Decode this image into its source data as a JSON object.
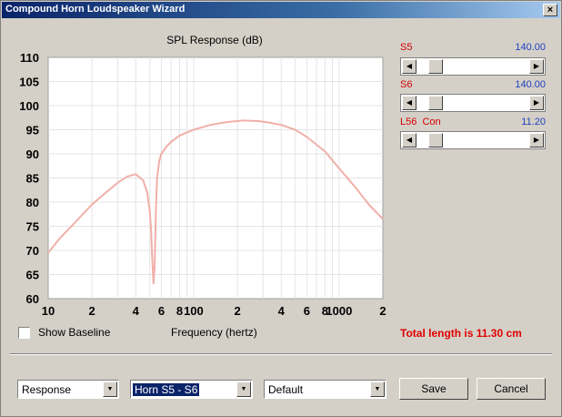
{
  "window": {
    "title": "Compound Horn Loudspeaker Wizard",
    "close_glyph": "×"
  },
  "sliders": [
    {
      "label": "S5",
      "value": "140.00",
      "level": 0.12
    },
    {
      "label": "S6",
      "value": "140.00",
      "level": 0.12
    },
    {
      "label": "L56  Con",
      "value": "11.20",
      "level": 0.12
    }
  ],
  "show_baseline": {
    "label": "Show Baseline",
    "checked": false
  },
  "total_length": "Total length is 11.30 cm",
  "bottom": {
    "view_select": "Response",
    "horn_select": "Horn S5 - S6",
    "preset_select": "Default",
    "save_label": "Save",
    "cancel_label": "Cancel"
  },
  "colors": {
    "curve": "#f0b0a8",
    "label_red": "#d40000",
    "value_blue": "#2040c0"
  },
  "chart_data": {
    "type": "line",
    "title": "SPL Response (dB)",
    "xlabel": "Frequency (hertz)",
    "ylabel": "",
    "x_scale": "log",
    "xlim": [
      10,
      2000
    ],
    "ylim": [
      60,
      110
    ],
    "y_ticks": [
      60,
      65,
      70,
      75,
      80,
      85,
      90,
      95,
      100,
      105,
      110
    ],
    "x_ticks": [
      {
        "v": 10,
        "label": "10"
      },
      {
        "v": 20,
        "label": "2"
      },
      {
        "v": 40,
        "label": "4"
      },
      {
        "v": 60,
        "label": "6"
      },
      {
        "v": 80,
        "label": "8"
      },
      {
        "v": 100,
        "label": "100"
      },
      {
        "v": 200,
        "label": "2"
      },
      {
        "v": 400,
        "label": "4"
      },
      {
        "v": 600,
        "label": "6"
      },
      {
        "v": 800,
        "label": "8"
      },
      {
        "v": 1000,
        "label": "1000"
      },
      {
        "v": 2000,
        "label": "2"
      }
    ],
    "grid": true,
    "series": [
      {
        "x": [
          10,
          12,
          15,
          20,
          25,
          30,
          35,
          40,
          45,
          48,
          50,
          51,
          52,
          53,
          54,
          55,
          56,
          58,
          60,
          65,
          70,
          80,
          100,
          130,
          170,
          220,
          280,
          330,
          400,
          500,
          600,
          800,
          1000,
          1300,
          1600,
          2000
        ],
        "y": [
          69.5,
          72.5,
          75.5,
          79.5,
          82,
          84,
          85.3,
          85.8,
          84.5,
          82,
          78,
          74,
          68,
          63,
          67,
          78,
          85,
          88.5,
          90,
          91.5,
          92.5,
          93.8,
          95,
          96,
          96.6,
          96.9,
          96.8,
          96.5,
          96,
          95,
          93.5,
          90.5,
          87,
          83,
          79.5,
          76.5
        ]
      }
    ]
  }
}
